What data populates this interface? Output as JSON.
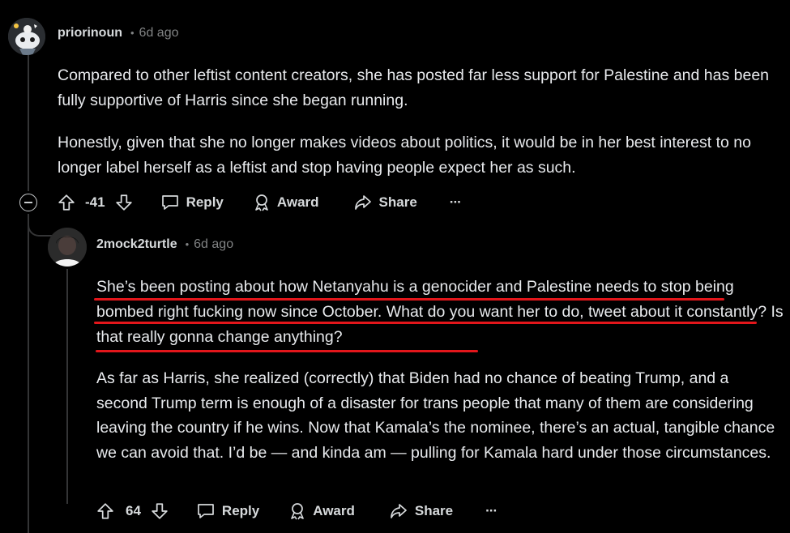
{
  "comment1": {
    "username": "priorinoun",
    "separator": "•",
    "time": "6d ago",
    "paragraphs": [
      "Compared to other leftist content creators, she has posted far less support for Palestine and has been fully supportive of Harris since she began running.",
      "Honestly, given that she no longer makes videos about politics, it would be in her best interest to no longer label herself as a leftist and stop having people expect her as such."
    ],
    "score": "-41",
    "reply_label": "Reply",
    "award_label": "Award",
    "share_label": "Share",
    "more_label": "···"
  },
  "comment2": {
    "username": "2mock2turtle",
    "separator": "•",
    "time": "6d ago",
    "paragraphs": [
      "She’s been posting about how Netanyahu is a genocider and Palestine needs to stop being bombed right fucking now since October. What do you want her to do, tweet about it constantly? Is that really gonna change anything?",
      "As far as Harris, she realized (correctly) that Biden had no chance of beating Trump, and a second Trump term is enough of a disaster for trans people that many of them are considering leaving the country if he wins. Now that Kamala’s the nominee, there’s an actual, tangible chance we can avoid that. I’d be — and kinda am — pulling for Kamala hard under those circumstances."
    ],
    "score": "64",
    "reply_label": "Reply",
    "award_label": "Award",
    "share_label": "Share",
    "more_label": "···"
  },
  "colors": {
    "background": "#000000",
    "text": "#d7dadc",
    "muted": "#818384",
    "annotation_underline": "#e3161b"
  },
  "icons": [
    "snoo-avatar",
    "user-avatar",
    "upvote-icon",
    "downvote-icon",
    "reply-icon",
    "award-icon",
    "share-icon",
    "more-icon",
    "collapse-icon"
  ]
}
